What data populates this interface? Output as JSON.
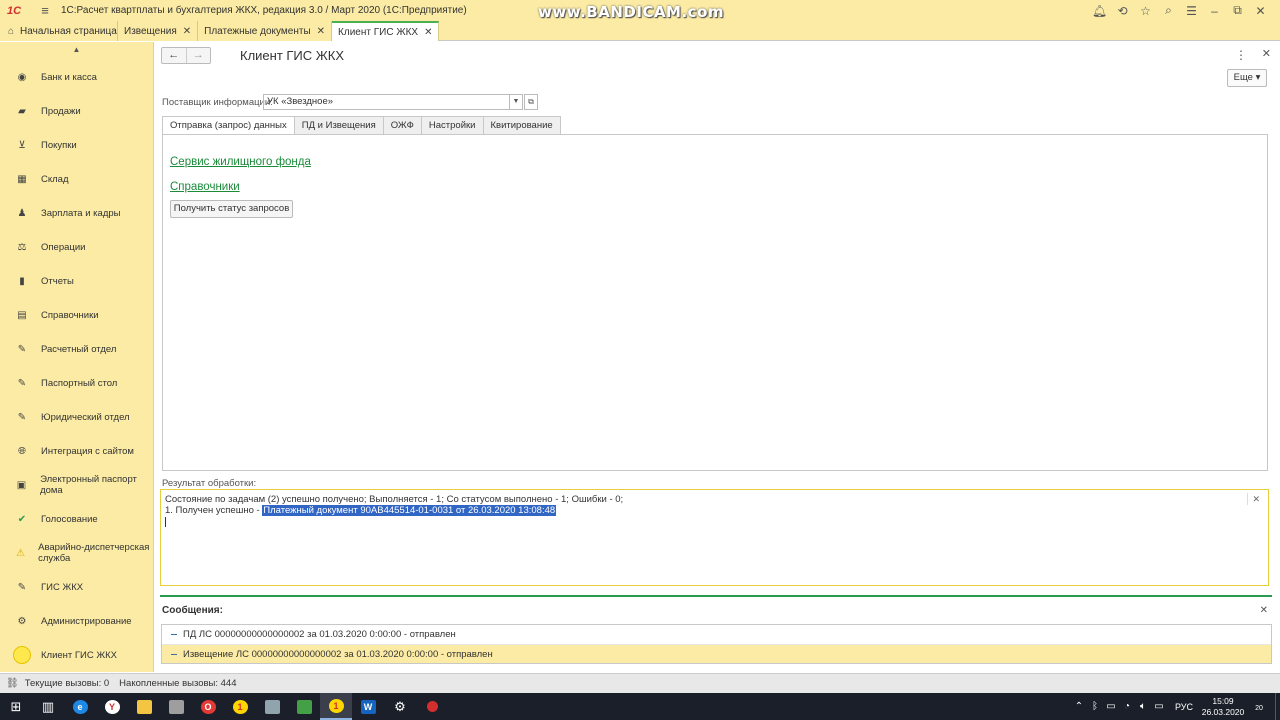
{
  "titlebar": {
    "logo": "1С",
    "title": "1С:Расчет квартплаты и бухгалтерия ЖКХ, редакция 3.0 / Март 2020  (1С:Предприятие)",
    "watermark": "www.BANDICAM.com",
    "icons": [
      "bell-icon",
      "history-icon",
      "star-icon",
      "search-icon",
      "settings-icon",
      "minimize-icon",
      "restore-icon",
      "close-icon"
    ]
  },
  "tabs": [
    {
      "label": "Начальная страница",
      "closable": false
    },
    {
      "label": "Извещения",
      "closable": true
    },
    {
      "label": "Платежные документы",
      "closable": true
    },
    {
      "label": "Клиент ГИС ЖКХ",
      "closable": true,
      "active": true
    }
  ],
  "sidebar": {
    "items": [
      {
        "label": "Банк и касса",
        "icon": "bank-icon"
      },
      {
        "label": "Продажи",
        "icon": "sales-icon"
      },
      {
        "label": "Покупки",
        "icon": "cart-icon"
      },
      {
        "label": "Склад",
        "icon": "warehouse-icon"
      },
      {
        "label": "Зарплата и кадры",
        "icon": "person-icon"
      },
      {
        "label": "Операции",
        "icon": "operations-icon"
      },
      {
        "label": "Отчеты",
        "icon": "reports-icon"
      },
      {
        "label": "Справочники",
        "icon": "book-icon"
      },
      {
        "label": "Расчетный отдел",
        "icon": "calc-icon"
      },
      {
        "label": "Паспортный стол",
        "icon": "passport-icon"
      },
      {
        "label": "Юридический отдел",
        "icon": "legal-icon"
      },
      {
        "label": "Интеграция с сайтом",
        "icon": "globe-icon"
      },
      {
        "label": "Электронный паспорт дома",
        "icon": "house-passport-icon"
      },
      {
        "label": "Голосование",
        "icon": "check-icon"
      },
      {
        "label": "Аварийно-диспетчерская служба",
        "icon": "warning-icon"
      },
      {
        "label": "ГИС ЖКХ",
        "icon": "gis-icon"
      },
      {
        "label": "Администрирование",
        "icon": "gear-icon"
      },
      {
        "label": "Клиент ГИС ЖКХ",
        "icon": "circle-icon",
        "active": true
      }
    ]
  },
  "main": {
    "title": "Клиент ГИС ЖКХ",
    "more_label": "Еще",
    "supplier_label": "Поставщик информации:",
    "supplier_value": "УК «Звездное»",
    "form_tabs": [
      "Отправка (запрос) данных",
      "ПД и Извещения",
      "ОЖФ",
      "Настройки",
      "Квитирование"
    ],
    "link1": "Сервис жилищного фонда",
    "link2": "Справочники",
    "status_button": "Получить статус запросов",
    "result_label": "Результат обработки:",
    "result_line1": "Состояние по задачам (2) успешно получено; Выполняется - 1; Со статусом выполнено - 1; Ошибки - 0;",
    "result_line2_prefix": "1. Получен успешно - ",
    "result_line2_highlight": "Платежный документ 90АВ445514-01-0031 от 26.03.2020 13:08:48",
    "messages_title": "Сообщения:",
    "messages": [
      "ПД ЛС 00000000000000002 за 01.03.2020 0:00:00 - отправлен",
      "Извещение ЛС 00000000000000002 за 01.03.2020 0:00:00 - отправлен"
    ]
  },
  "statusbar": {
    "current_calls": "Текущие вызовы: 0",
    "accumulated_calls": "Накопленные вызовы: 444"
  },
  "taskbar": {
    "lang": "РУС",
    "time": "15:09",
    "date": "26.03.2020",
    "notif_count": "20"
  }
}
